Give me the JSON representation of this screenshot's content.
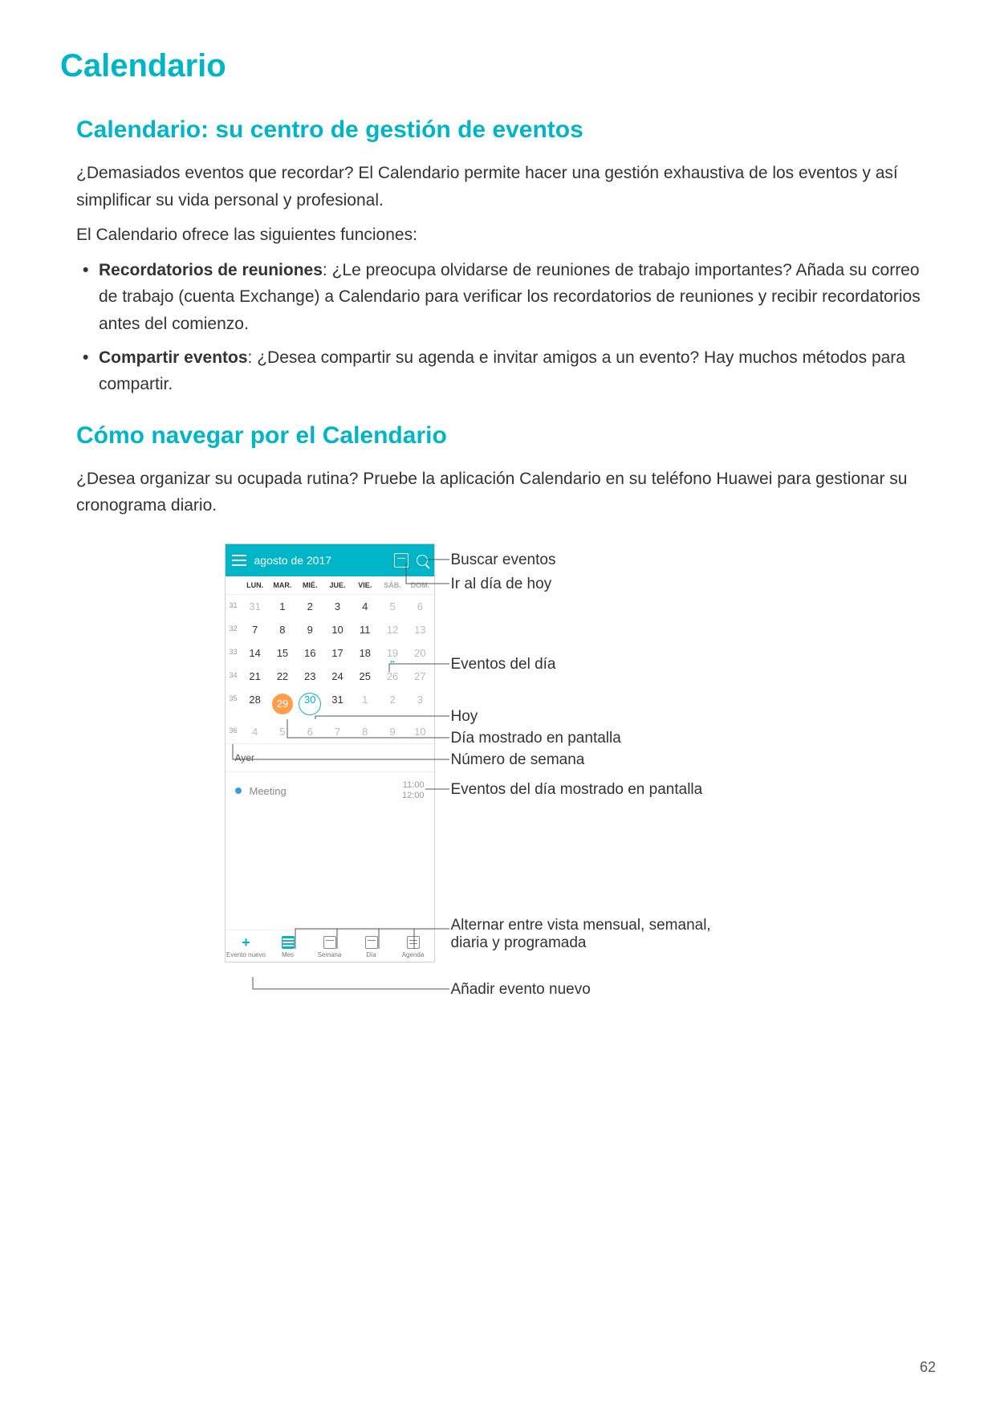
{
  "page_number": "62",
  "h1": "Calendario",
  "section1": {
    "title": "Calendario: su centro de gestión de eventos",
    "p1": "¿Demasiados eventos que recordar? El Calendario permite hacer una gestión exhaustiva de los eventos y así simplificar su vida personal y profesional.",
    "p2": "El Calendario ofrece las siguientes funciones:",
    "bullets": [
      {
        "b": "Recordatorios de reuniones",
        "t": ": ¿Le preocupa olvidarse de reuniones de trabajo importantes? Añada su correo de trabajo (cuenta Exchange) a Calendario para verificar los recordatorios de reuniones y recibir recordatorios antes del comienzo."
      },
      {
        "b": "Compartir eventos",
        "t": ": ¿Desea compartir su agenda e invitar amigos a un evento? Hay muchos métodos para compartir."
      }
    ]
  },
  "section2": {
    "title": "Cómo navegar por el Calendario",
    "p1": "¿Desea organizar su ocupada rutina? Pruebe la aplicación Calendario en su teléfono Huawei para gestionar su cronograma diario."
  },
  "phone": {
    "header_title": "agosto de 2017",
    "weekdays": [
      "LUN.",
      "MAR.",
      "MIÉ.",
      "JUE.",
      "VIE.",
      "SÁB.",
      "DOM."
    ],
    "weeks": [
      {
        "wk": "31",
        "days": [
          {
            "n": "31",
            "cls": "other"
          },
          {
            "n": "1"
          },
          {
            "n": "2"
          },
          {
            "n": "3"
          },
          {
            "n": "4"
          },
          {
            "n": "5",
            "cls": "wkend"
          },
          {
            "n": "6",
            "cls": "wkend"
          }
        ]
      },
      {
        "wk": "32",
        "days": [
          {
            "n": "7"
          },
          {
            "n": "8"
          },
          {
            "n": "9"
          },
          {
            "n": "10"
          },
          {
            "n": "11"
          },
          {
            "n": "12",
            "cls": "wkend"
          },
          {
            "n": "13",
            "cls": "wkend"
          }
        ]
      },
      {
        "wk": "33",
        "days": [
          {
            "n": "14"
          },
          {
            "n": "15"
          },
          {
            "n": "16"
          },
          {
            "n": "17"
          },
          {
            "n": "18"
          },
          {
            "n": "19",
            "cls": "wkend",
            "dots": "••"
          },
          {
            "n": "20",
            "cls": "wkend"
          }
        ]
      },
      {
        "wk": "34",
        "days": [
          {
            "n": "21"
          },
          {
            "n": "22"
          },
          {
            "n": "23"
          },
          {
            "n": "24"
          },
          {
            "n": "25"
          },
          {
            "n": "26",
            "cls": "wkend"
          },
          {
            "n": "27",
            "cls": "wkend"
          }
        ]
      },
      {
        "wk": "35",
        "days": [
          {
            "n": "28"
          },
          {
            "n": "29",
            "cls": "selected"
          },
          {
            "n": "30",
            "cls": "today"
          },
          {
            "n": "31"
          },
          {
            "n": "1",
            "cls": "other"
          },
          {
            "n": "2",
            "cls": "other"
          },
          {
            "n": "3",
            "cls": "other"
          }
        ]
      },
      {
        "wk": "36",
        "days": [
          {
            "n": "4",
            "cls": "other"
          },
          {
            "n": "5",
            "cls": "other"
          },
          {
            "n": "6",
            "cls": "other"
          },
          {
            "n": "7",
            "cls": "other"
          },
          {
            "n": "8",
            "cls": "other"
          },
          {
            "n": "9",
            "cls": "other"
          },
          {
            "n": "10",
            "cls": "other"
          }
        ]
      }
    ],
    "list_header": "Ayer",
    "event": {
      "name": "Meeting",
      "t1": "11:00",
      "t2": "12:00"
    },
    "bottom": [
      "Evento nuevo",
      "Mes",
      "Semana",
      "Día",
      "Agenda"
    ]
  },
  "callouts": {
    "c1": "Buscar eventos",
    "c2": "Ir al día de hoy",
    "c3": "Eventos del día",
    "c4": "Hoy",
    "c5": "Día mostrado en pantalla",
    "c6": "Número de semana",
    "c7": "Eventos del día mostrado en pantalla",
    "c8": "Alternar entre vista mensual, semanal, diaria y programada",
    "c9": "Añadir evento nuevo"
  }
}
